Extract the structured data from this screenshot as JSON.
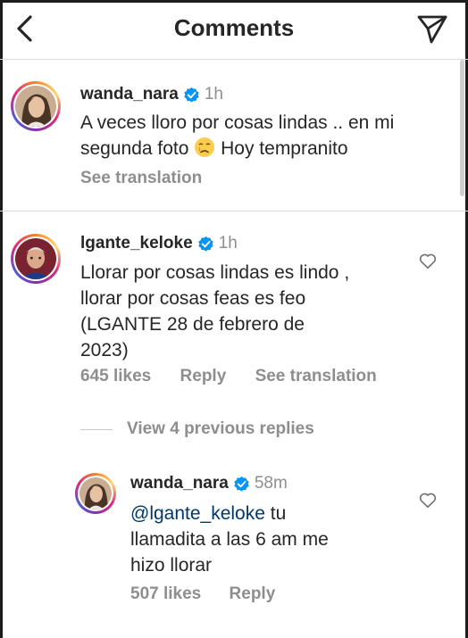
{
  "header": {
    "title": "Comments",
    "back_icon": "chevron-left-icon",
    "share_icon": "paper-plane-icon"
  },
  "caption": {
    "username": "wanda_nara",
    "time": "1h",
    "text_line1": "A veces lloro por cosas lindas .. en mi",
    "text_line2_a": "segunda foto",
    "emoji": "crying-face-emoji",
    "text_line2_b": "Hoy tempranito",
    "see_translation": "See translation"
  },
  "comment": {
    "username": "lgante_keloke",
    "time": "1h",
    "lines": [
      "Llorar por cosas lindas es lindo ,",
      "llorar por cosas feas es feo",
      "(LGANTE 28 de febrero de",
      "2023)"
    ],
    "likes": "645 likes",
    "reply": "Reply",
    "see_translation": "See translation",
    "view_replies": "View 4 previous replies"
  },
  "reply": {
    "username": "wanda_nara",
    "time": "58m",
    "mention": "@lgante_keloke",
    "text_after_mention": " tu",
    "lines": [
      "llamadita a las 6 am me",
      "hizo llorar"
    ],
    "likes": "507 likes",
    "reply": "Reply"
  },
  "colors": {
    "text": "#262626",
    "secondary": "#8e8e8e",
    "verified_blue": "#0095f6",
    "mention": "#00376b",
    "divider": "#dbdbdb"
  }
}
